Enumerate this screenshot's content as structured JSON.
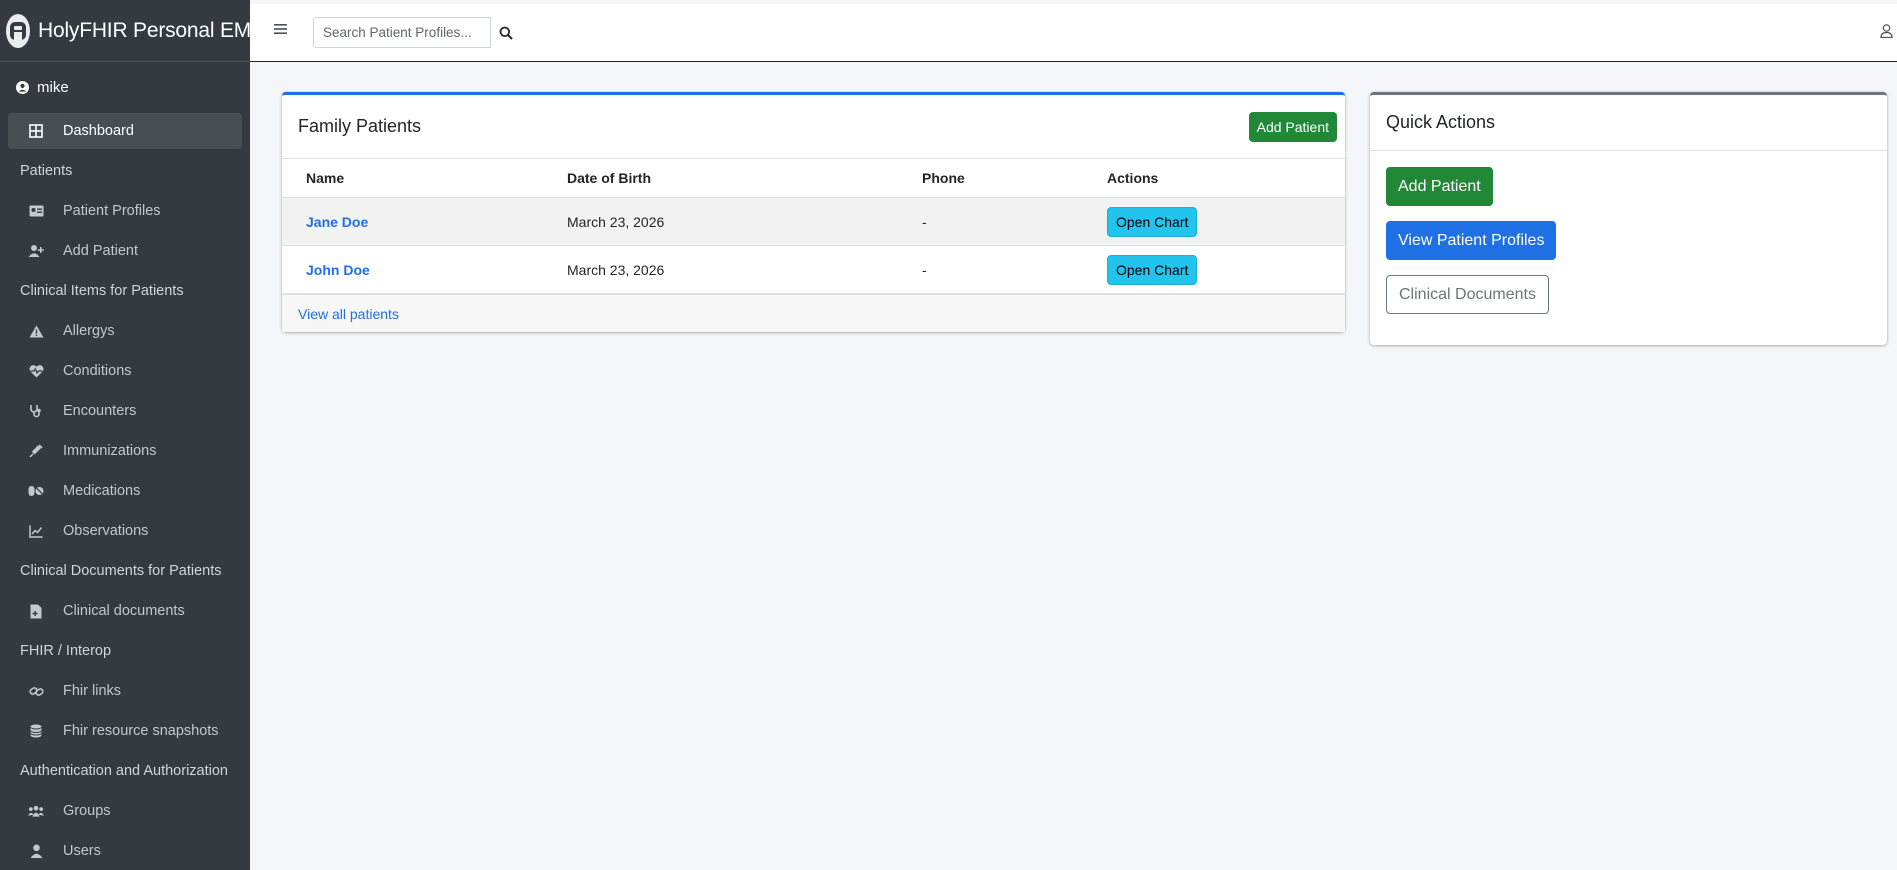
{
  "brand": {
    "title": "HolyFHIR Personal EMR",
    "logo_letter": "A"
  },
  "user": {
    "name": "mike"
  },
  "sidebar": {
    "dashboard": "Dashboard",
    "sections": {
      "patients": "Patients",
      "clinical_items": "Clinical Items for Patients",
      "clinical_documents": "Clinical Documents for Patients",
      "fhir": "FHIR / Interop",
      "auth": "Authentication and Authorization"
    },
    "items": {
      "patient_profiles": "Patient Profiles",
      "add_patient": "Add Patient",
      "allergys": "Allergys",
      "conditions": "Conditions",
      "encounters": "Encounters",
      "immunizations": "Immunizations",
      "medications": "Medications",
      "observations": "Observations",
      "clinical_documents": "Clinical documents",
      "fhir_links": "Fhir links",
      "fhir_snapshots": "Fhir resource snapshots",
      "groups": "Groups",
      "users": "Users"
    }
  },
  "search": {
    "placeholder": "Search Patient Profiles..."
  },
  "family": {
    "title": "Family Patients",
    "add_button": "Add Patient",
    "columns": [
      "Name",
      "Date of Birth",
      "Phone",
      "Actions"
    ],
    "rows": [
      {
        "name": "Jane Doe",
        "dob": "March 23, 2026",
        "phone": "-",
        "action": "Open Chart"
      },
      {
        "name": "John Doe",
        "dob": "March 23, 2026",
        "phone": "-",
        "action": "Open Chart"
      }
    ],
    "footer_link": "View all patients"
  },
  "quick": {
    "title": "Quick Actions",
    "add_patient": "Add Patient",
    "view_profiles": "View Patient Profiles",
    "clinical_documents": "Clinical Documents"
  },
  "colors": {
    "sidebar_bg": "#343a40",
    "primary": "#1f6fe5",
    "success": "#218838",
    "info": "#22c3ec"
  }
}
